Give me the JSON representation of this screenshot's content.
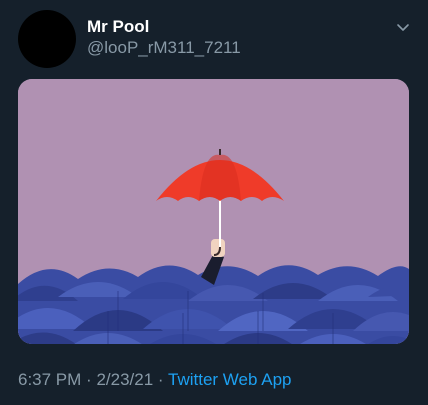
{
  "tweet": {
    "author": {
      "name": "Mr Pool",
      "handle": "@looP_rM311_7211"
    },
    "image": {
      "description_icon": "umbrella-illustration",
      "colors": {
        "background": "#b091b2",
        "highlight_umbrella": "#ef3b29",
        "crowd_umbrellas": "#3c4fa8"
      }
    },
    "meta": {
      "time": "6:37 PM",
      "separator1": "·",
      "date": "2/23/21",
      "separator2": "·",
      "source": "Twitter Web App"
    }
  },
  "theme": {
    "background": "#15202b",
    "text_primary": "#ffffff",
    "text_secondary": "#8899a6",
    "accent": "#1da1f2"
  }
}
